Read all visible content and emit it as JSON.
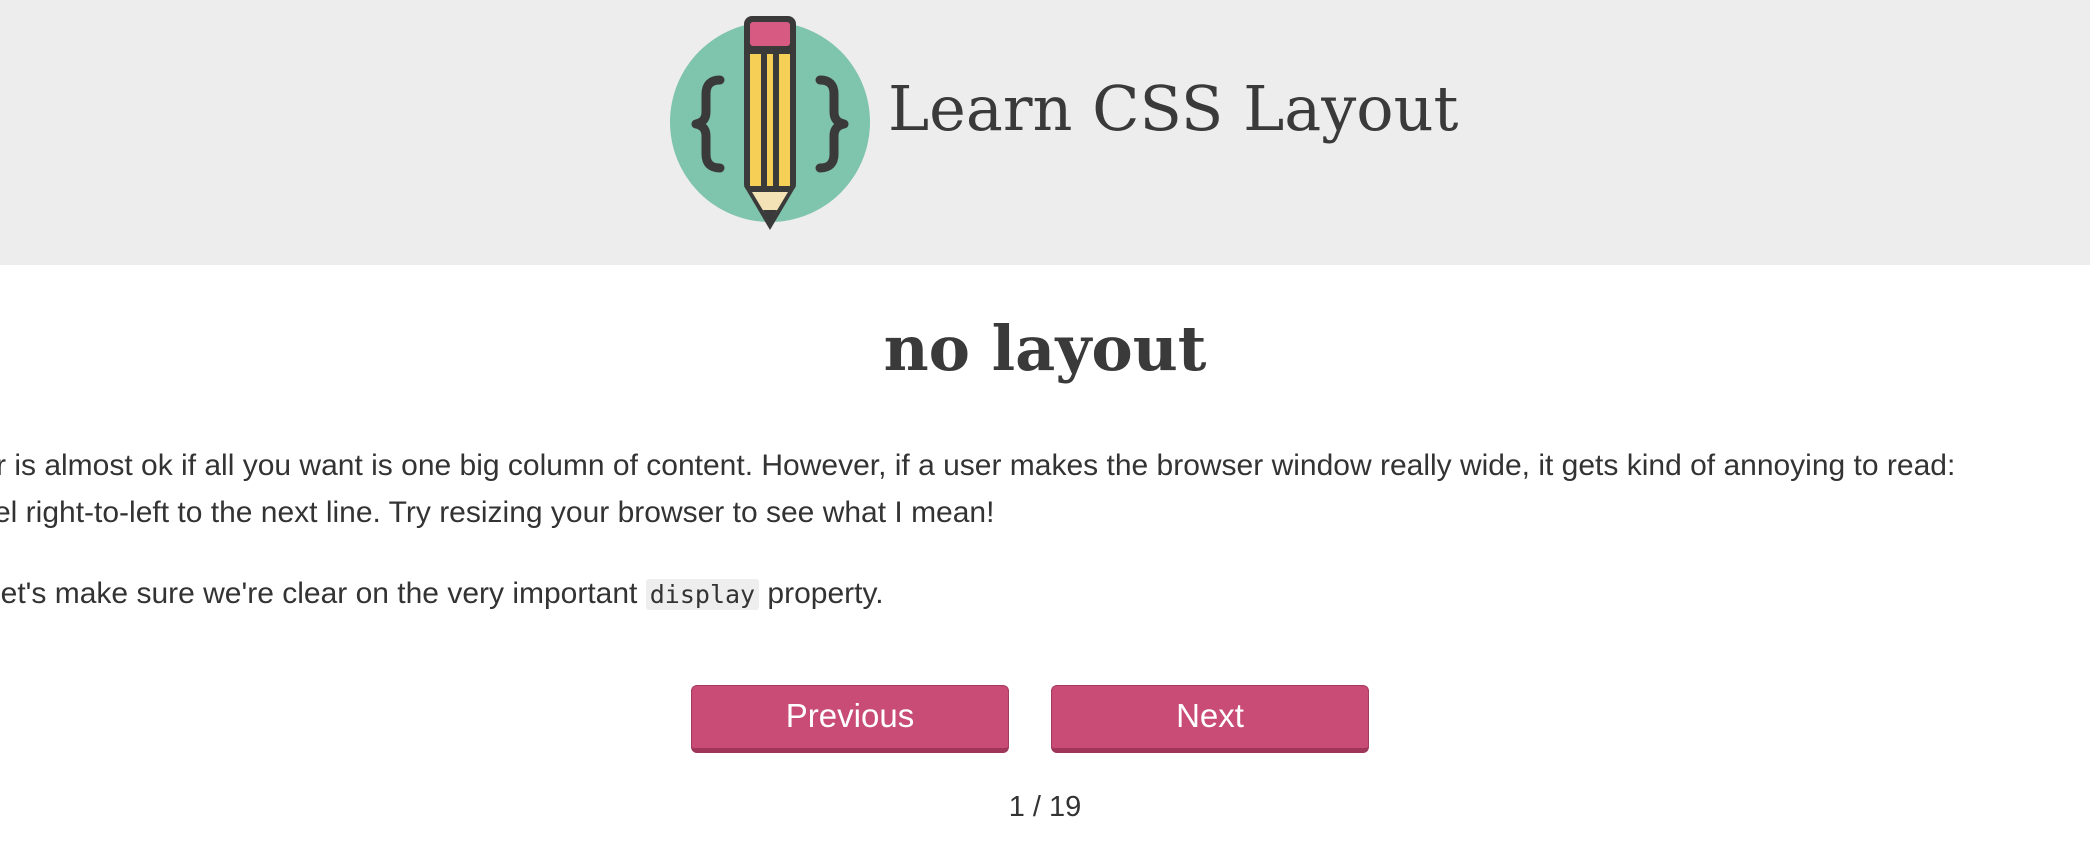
{
  "header": {
    "site_title": "Learn CSS Layout",
    "logo_icon": "pencil-braces-logo-icon"
  },
  "main": {
    "page_title": "no layout",
    "paragraph1_line1": "r is almost ok if all you want is one big column of content. However, if a user makes the browser window really wide, it gets kind of annoying to read:",
    "paragraph1_line2": "el right-to-left to the next line. Try resizing your browser to see what I mean!",
    "paragraph2_before": "let's make sure we're clear on the very important ",
    "paragraph2_code": "display",
    "paragraph2_after": " property."
  },
  "nav": {
    "previous_label": "Previous",
    "next_label": "Next",
    "page_indicator": "1 / 19"
  },
  "colors": {
    "header_bg": "#ededed",
    "button_bg": "#c84c75",
    "logo_circle": "#7fc4ac",
    "pencil_yellow": "#f6cf57",
    "pencil_eraser": "#d65a82"
  }
}
